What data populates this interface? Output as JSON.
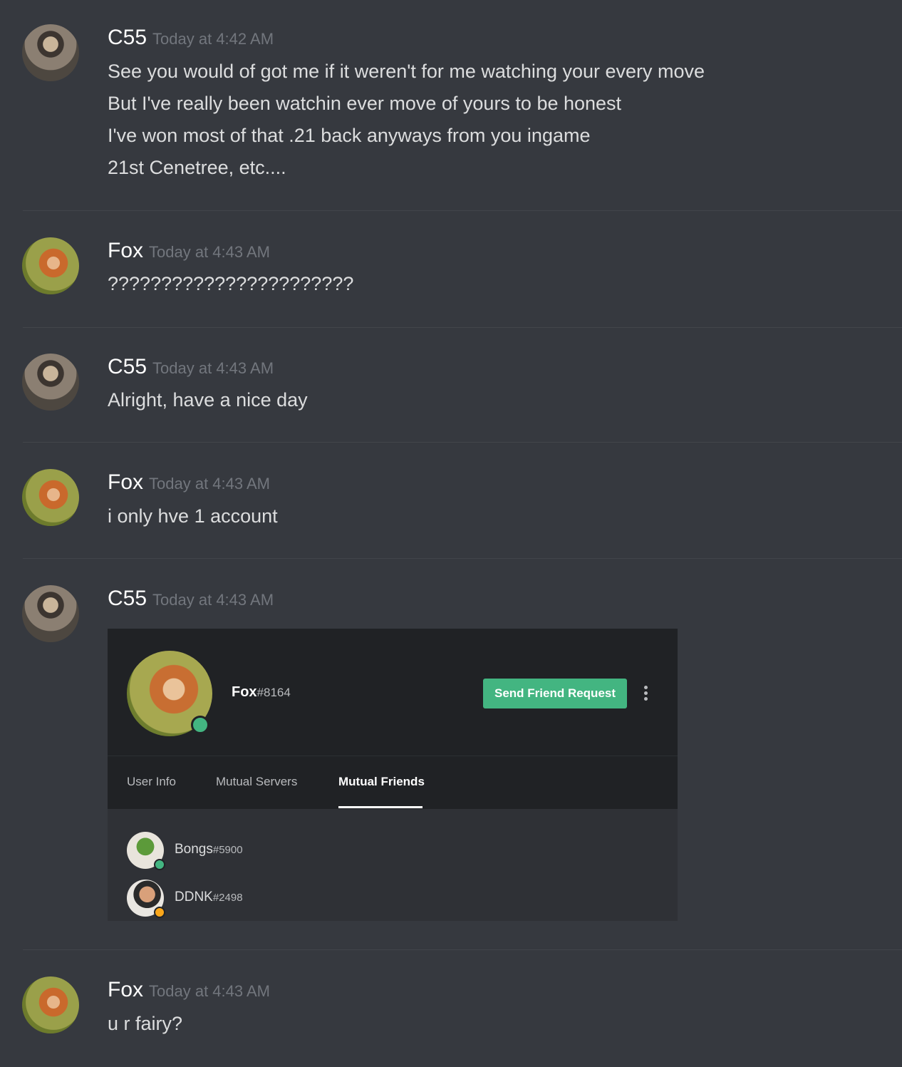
{
  "messages": [
    {
      "author": "C55",
      "timestamp": "Today at 4:42 AM",
      "lines": [
        "See you would of got me if it weren't for me watching your every move",
        "But I've really been watchin ever move of yours to be honest",
        "I've won most of that .21 back anyways from you ingame",
        "21st Cenetree, etc...."
      ]
    },
    {
      "author": "Fox",
      "timestamp": "Today at 4:43 AM",
      "lines": [
        "???????????????????????"
      ]
    },
    {
      "author": "C55",
      "timestamp": "Today at 4:43 AM",
      "lines": [
        "Alright, have a nice day"
      ]
    },
    {
      "author": "Fox",
      "timestamp": "Today at 4:43 AM",
      "lines": [
        "i only hve 1 account"
      ]
    },
    {
      "author": "C55",
      "timestamp": "Today at 4:43 AM",
      "lines": []
    },
    {
      "author": "Fox",
      "timestamp": "Today at 4:43 AM",
      "lines": [
        "u r fairy?"
      ]
    }
  ],
  "profile_embed": {
    "username": "Fox",
    "discriminator": "#8164",
    "status_color": "#43b581",
    "send_friend_request_label": "Send Friend Request",
    "tabs": [
      "User Info",
      "Mutual Servers",
      "Mutual Friends"
    ],
    "active_tab": "Mutual Friends",
    "mutual_friends": [
      {
        "name": "Bongs",
        "discriminator": "#5900",
        "status_color": "#43b581"
      },
      {
        "name": "DDNK",
        "discriminator": "#2498",
        "status_color": "#faa61a"
      }
    ]
  }
}
